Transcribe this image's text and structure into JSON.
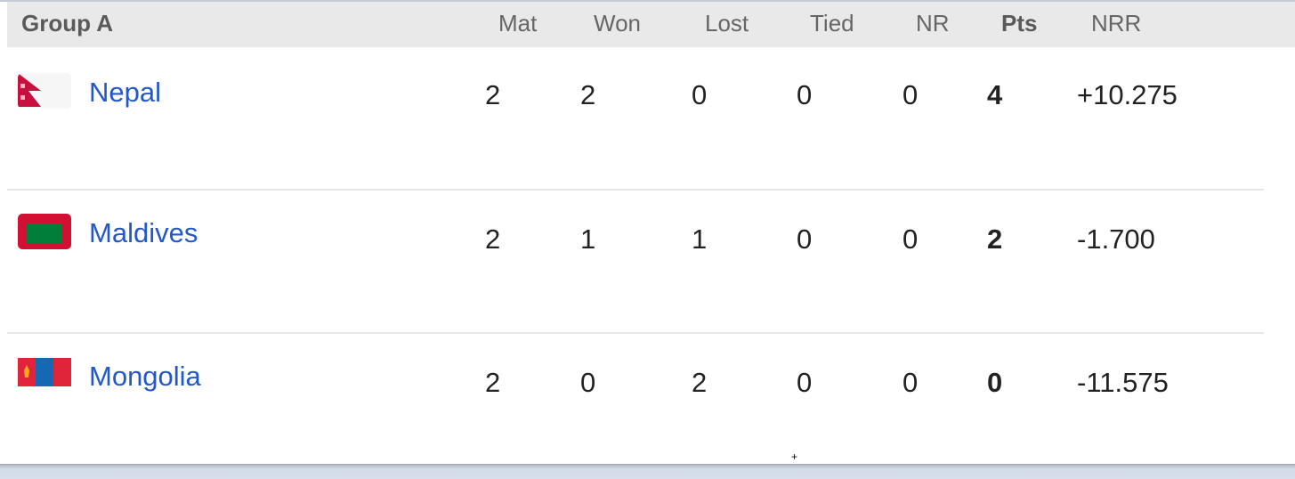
{
  "group": {
    "title": "Group A"
  },
  "columns": [
    "Mat",
    "Won",
    "Lost",
    "Tied",
    "NR",
    "Pts",
    "NRR"
  ],
  "teams": [
    {
      "name": "Nepal",
      "flag": "nepal-flag",
      "mat": "2",
      "won": "2",
      "lost": "0",
      "tied": "0",
      "nr": "0",
      "pts": "4",
      "nrr": "+10.275"
    },
    {
      "name": "Maldives",
      "flag": "maldives-flag",
      "mat": "2",
      "won": "1",
      "lost": "1",
      "tied": "0",
      "nr": "0",
      "pts": "2",
      "nrr": "-1.700"
    },
    {
      "name": "Mongolia",
      "flag": "mongolia-flag",
      "mat": "2",
      "won": "0",
      "lost": "2",
      "tied": "0",
      "nr": "0",
      "pts": "0",
      "nrr": "-11.575"
    }
  ],
  "colors": {
    "link": "#2358c7",
    "header_bg": "#e9e9e9",
    "nepal_crimson": "#c8103e",
    "maldives_red": "#d21034",
    "maldives_green": "#007e3a",
    "mongolia_red": "#e0243a",
    "mongolia_blue": "#1668b5",
    "soyombo_gold": "#f9c818"
  }
}
